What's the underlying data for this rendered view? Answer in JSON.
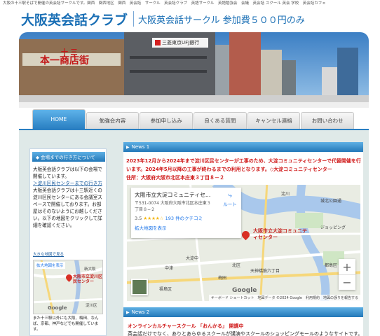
{
  "top_keywords": "大阪の十三駅そばで開催の英会話サークルです。関西　関西地区　関西　英会話　サークル　英会話クラブ　英語サークル　英語勉強会　会議　英会話 スクール 英会 学校　英会話カフェ",
  "header": {
    "logo": "大阪英会話クラブ",
    "subtitle": "大阪英会話サークル 参加費５００円のみ"
  },
  "hero": {
    "sign_left_top": "十 三",
    "sign_left": "本一商店街",
    "sign_bank": "三菱東京UFJ銀行"
  },
  "nav": {
    "tabs": [
      "HOME",
      "勉強会内容",
      "参加申し込み",
      "良くある質問",
      "キャンセル連絡",
      "お問い合わせ"
    ]
  },
  "sidebar": {
    "heading": "◆ 会場までの行き方について",
    "text_1": "大阪英会話クラブは以下の会場で開催しています。",
    "link": "＞淀川区民センターまでの行き方",
    "text_2": "大阪英会話クラブは十三駅近くの淀川区民センターにある会議室スペースで開催しております。お部屋はそのないようにお越しください。以下の地図をクリックして詳細を確認ください。",
    "small_link": "大きな地図で見る",
    "mini_map": {
      "enlarge": "拡大地図を表示",
      "label": "大阪市立淀川区民センター",
      "label_right": "新大阪",
      "label_bottom_right": "淀川区"
    },
    "bottom_text": "また十三駅以外にも大阪、梅田、なんば、京都、神戸などでも開催しています。"
  },
  "news": {
    "n1_heading": "News 1",
    "n1_text": "2023年12月から2024年まで淀川区民センターが工事のため、大淀コミュニティセンターで代替開催を行います。2024年5月以降の工事が終わるまでの利用となります。◇大淀コミュニティセンター",
    "n1_addr": "住所：大阪府大阪市北区本庄東３丁目８－２",
    "n2_heading": "News 2",
    "n2_title": "オンラインカルチャースクール 「おんかる」 開講中",
    "n2_text": "英会話だけでなく、ありとあらゆるスクールが講演やスクールのショッピングモールのようなサイトです。ビ"
  },
  "map": {
    "card_title": "大阪市立大淀コミュニティセ...",
    "card_addr": "〒531-0074 大阪府大阪市北区本庄東３丁目８−２",
    "rating": "3.5",
    "stars": "★★★★☆",
    "reviews": "193 件のクチコミ",
    "enlarge": "拡大地図を表示",
    "route": "ルート",
    "marker_label": "大阪市立大淀コミュニティセンター",
    "labels": {
      "a": "淀川",
      "b": "城北公園通",
      "c": "都島区",
      "d": "天神橋筋六丁目",
      "e": "大淀中",
      "f": "梅田",
      "g": "北区",
      "h": "中津",
      "i": "福島区",
      "j": "ジョッピング"
    },
    "attribution": "キーボード ショートカット　地図データ ©2024 Google　利用規約　地図の誤りを報告する",
    "google": "Google"
  },
  "colors": {
    "brand_blue": "#1a6fb5",
    "news_red": "#d01a1a",
    "tab_active": "#2a7fc2"
  }
}
